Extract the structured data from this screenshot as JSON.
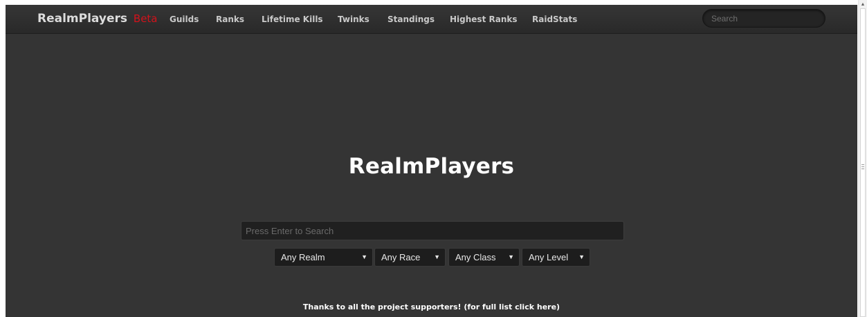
{
  "navbar": {
    "brand": "RealmPlayers",
    "brand_badge": "Beta",
    "links": [
      "Guilds",
      "Ranks",
      "Lifetime Kills",
      "Twinks",
      "Standings",
      "Highest Ranks",
      "RaidStats"
    ],
    "search_placeholder": "Search"
  },
  "hero": {
    "title": "RealmPlayers"
  },
  "search": {
    "placeholder": "Press Enter to Search"
  },
  "filters": {
    "realm": "Any Realm",
    "race": "Any Race",
    "class": "Any Class",
    "level": "Any Level",
    "arrow_icon": "triangle-down"
  },
  "footer": {
    "supporters_text": "Thanks to all the project supporters! (for full list click here)"
  },
  "colors": {
    "background": "#343434",
    "navbar": "#2e2e2e",
    "beta_badge": "#d3121b",
    "text": "#ffffff"
  }
}
